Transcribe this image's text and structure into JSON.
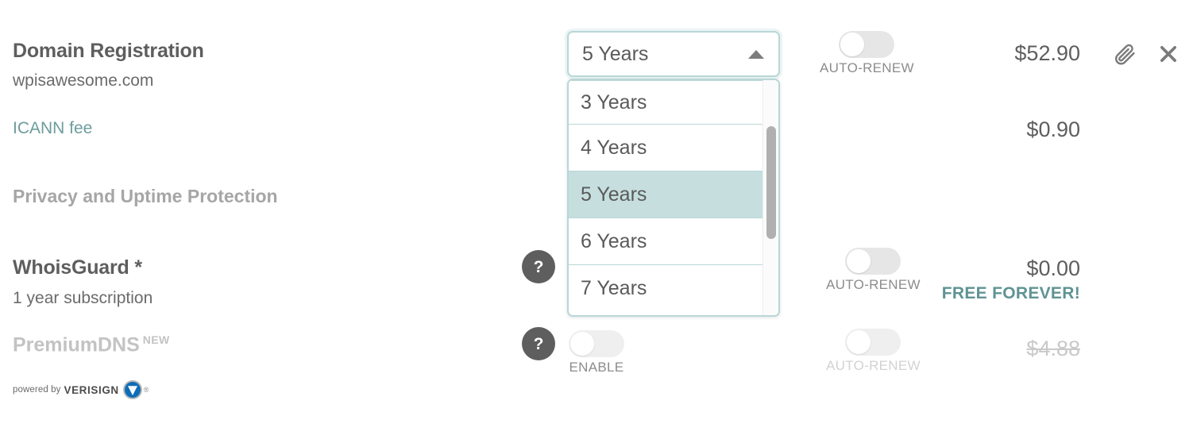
{
  "rows": {
    "domain": {
      "title": "Domain Registration",
      "subtitle": "wpisawesome.com",
      "price": "$52.90",
      "autorenew_label": "AUTO-RENEW",
      "attach_icon": "paperclip-icon",
      "remove_icon": "close-icon"
    },
    "icann": {
      "label": "ICANN fee",
      "price": "$0.90"
    },
    "protection_section": {
      "heading": "Privacy and Uptime Protection"
    },
    "whoisguard": {
      "title": "WhoisGuard *",
      "subtitle": "1 year subscription",
      "help_glyph": "?",
      "autorenew_label": "AUTO-RENEW",
      "price": "$0.00",
      "promo": "FREE FOREVER!"
    },
    "premiumdns": {
      "title": "PremiumDNS",
      "badge": "NEW",
      "help_glyph": "?",
      "enable_label": "ENABLE",
      "autorenew_label": "AUTO-RENEW",
      "price": "$4.88",
      "powered_by": "powered by",
      "vendor": "VERISIGN",
      "vendor_reg": "®"
    }
  },
  "year_select": {
    "value": "5 Years",
    "expanded": true,
    "caret_icon": "caret-up-icon",
    "options": [
      {
        "label": "3 Years",
        "selected": false
      },
      {
        "label": "4 Years",
        "selected": false
      },
      {
        "label": "5 Years",
        "selected": true
      },
      {
        "label": "6 Years",
        "selected": false
      },
      {
        "label": "7 Years",
        "selected": false
      }
    ]
  },
  "colors": {
    "teal_border": "#b9d7d7",
    "teal_highlight": "#c6dede",
    "teal_text": "#6d9c9c",
    "promo_text": "#5f9393",
    "title_gray": "#5e5e5e",
    "muted_gray": "#c3c3c3",
    "verisign_blue": "#0f6cb6"
  }
}
